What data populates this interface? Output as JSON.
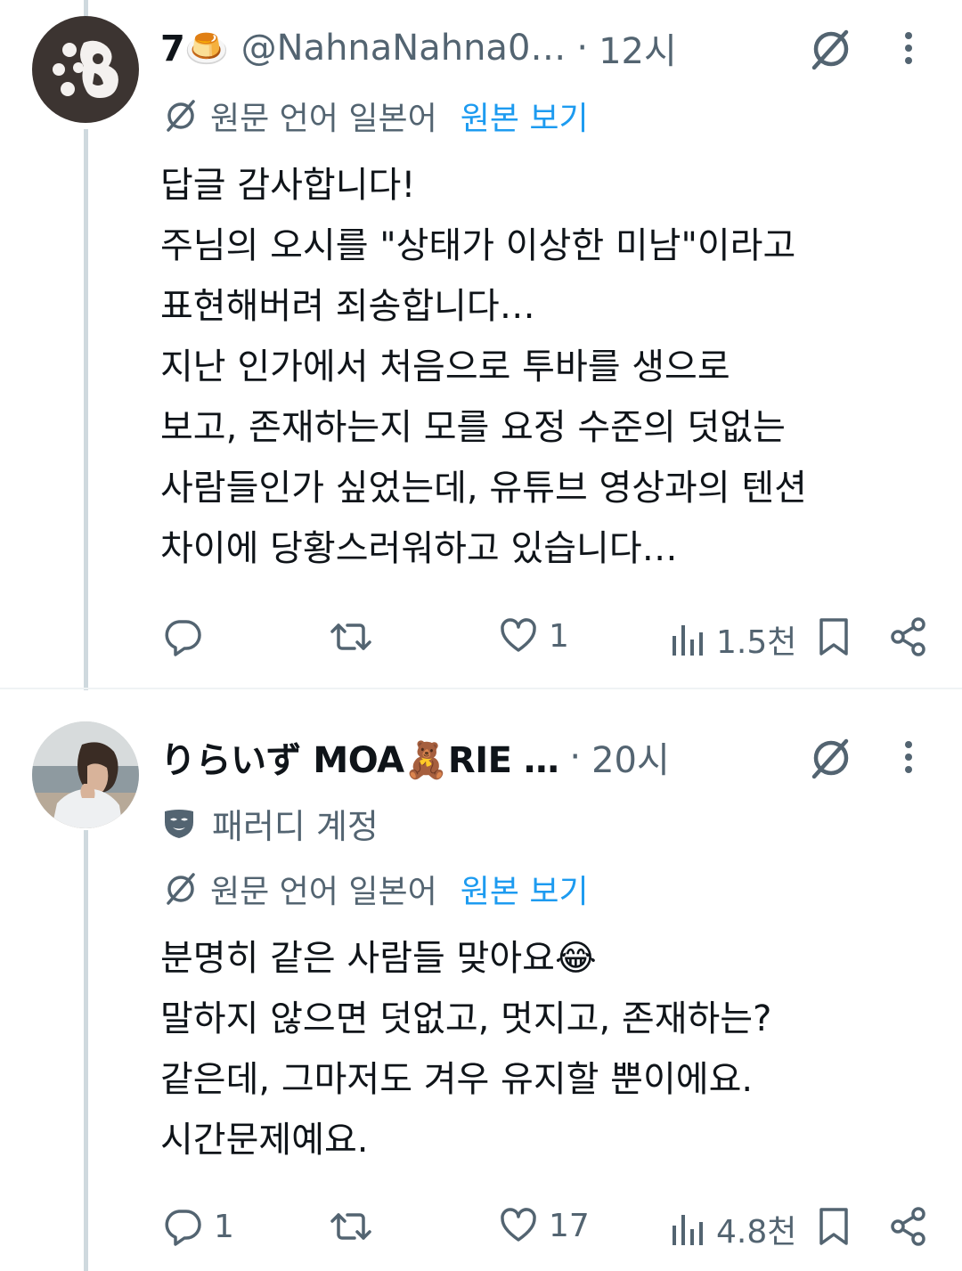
{
  "tweets": [
    {
      "name": "7🍮",
      "handle": "@NahnaNahna0…",
      "time": "12시",
      "translation": {
        "label": "원문 언어 일본어",
        "link": "원본 보기"
      },
      "lines": [
        "답글 감사합니다!",
        "주님의 오시를 \"상태가 이상한 미남\"이라고",
        "표현해버려 죄송합니다…",
        "지난 인가에서 처음으로 투바를 생으로",
        "보고, 존재하는지 모를 요정 수준의 덧없는",
        "사람들인가 싶었는데, 유튜브 영상과의 텐션",
        "차이에 당황스러워하고 있습니다…"
      ],
      "stats": {
        "replies": "",
        "retweets": "",
        "likes": "1",
        "views": "1.5천"
      }
    },
    {
      "name": "りらいず MOA🧸RIE …",
      "handle": "",
      "time": "20시",
      "parody_label": "패러디 계정",
      "translation": {
        "label": "원문 언어 일본어",
        "link": "원본 보기"
      },
      "lines": [
        "분명히 같은 사람들 맞아요😂",
        "말하지 않으면 덧없고, 멋지고, 존재하는?",
        "같은데, 그마저도 겨우 유지할 뿐이에요.",
        "시간문제예요."
      ],
      "stats": {
        "replies": "1",
        "retweets": "",
        "likes": "17",
        "views": "4.8천"
      }
    }
  ],
  "colors": {
    "text": "#0f1419",
    "secondary": "#536471",
    "link": "#1d9bf0",
    "thread": "#cfd9de"
  },
  "icons": [
    "grok-slash-icon",
    "more-icon",
    "translate-icon",
    "parody-mask-icon",
    "reply-icon",
    "retweet-icon",
    "like-icon",
    "views-icon",
    "bookmark-icon",
    "share-icon"
  ]
}
